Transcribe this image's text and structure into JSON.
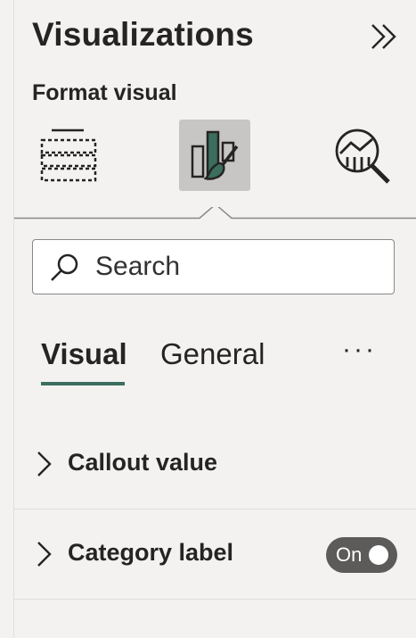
{
  "pane": {
    "title": "Visualizations",
    "subtitle": "Format visual"
  },
  "icon_tabs": [
    {
      "name": "fields-icon",
      "selected": false
    },
    {
      "name": "format-paintbrush-icon",
      "selected": true
    },
    {
      "name": "analytics-icon",
      "selected": false
    }
  ],
  "search": {
    "placeholder": "Search",
    "value": ""
  },
  "format_tabs": {
    "visual": "Visual",
    "general": "General",
    "more": "···",
    "active": "Visual"
  },
  "sections": {
    "callout_value": {
      "label": "Callout value"
    },
    "category_label": {
      "label": "Category label",
      "toggle": "On"
    }
  },
  "colors": {
    "accent": "#3b6e5f",
    "background": "#f3f2f1",
    "toggle_on": "#5c5b5a"
  }
}
